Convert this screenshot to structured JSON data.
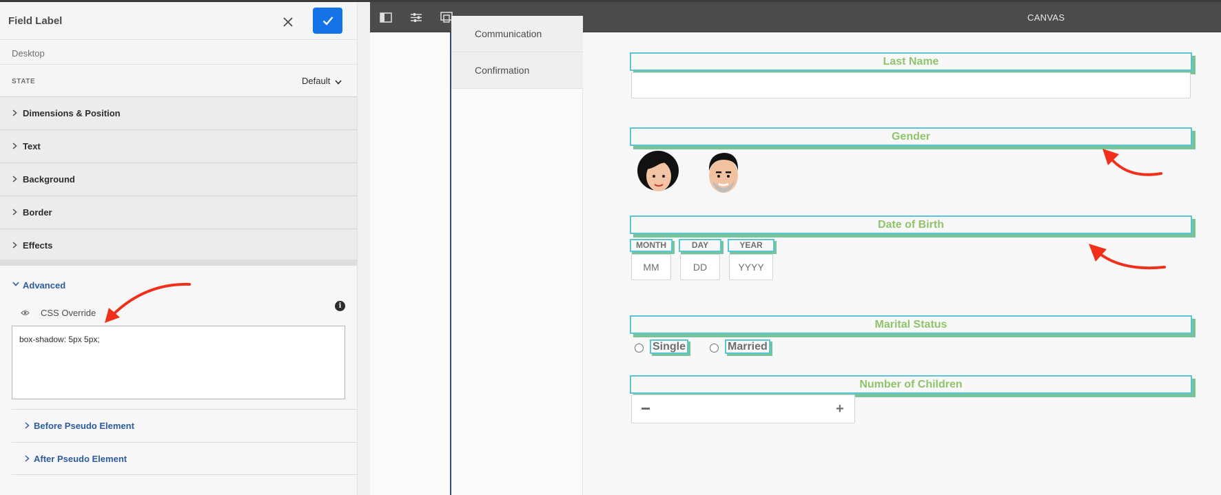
{
  "panel": {
    "title": "Field Label",
    "device": "Desktop",
    "state_label": "STATE",
    "state_value": "Default",
    "sections": [
      "Dimensions & Position",
      "Text",
      "Background",
      "Border",
      "Effects"
    ],
    "advanced": {
      "title": "Advanced",
      "css_override_label": "CSS Override",
      "css_override_value": "box-shadow: 5px 5px;",
      "before_pseudo": "Before Pseudo Element",
      "after_pseudo": "After Pseudo Element"
    }
  },
  "toolbar": {
    "title": "CANVAS",
    "icons": [
      "sidebar-toggle-icon",
      "properties-icon",
      "preview-icon"
    ]
  },
  "nav": {
    "items": [
      "Communication",
      "Confirmation"
    ]
  },
  "form": {
    "last_name_label": "Last Name",
    "gender_label": "Gender",
    "dob_label": "Date of Birth",
    "month_label": "MONTH",
    "day_label": "DAY",
    "year_label": "YEAR",
    "month_placeholder": "MM",
    "day_placeholder": "DD",
    "year_placeholder": "YYYY",
    "marital_label": "Marital Status",
    "marital_options": [
      "Single",
      "Married"
    ],
    "children_label": "Number of Children"
  },
  "colors": {
    "accent_blue": "#1473e6",
    "label_text_green": "#8fc46a",
    "label_border_teal": "#59c4d2",
    "shadow_green": "#77c49b",
    "annotation_red": "#f0301a"
  }
}
